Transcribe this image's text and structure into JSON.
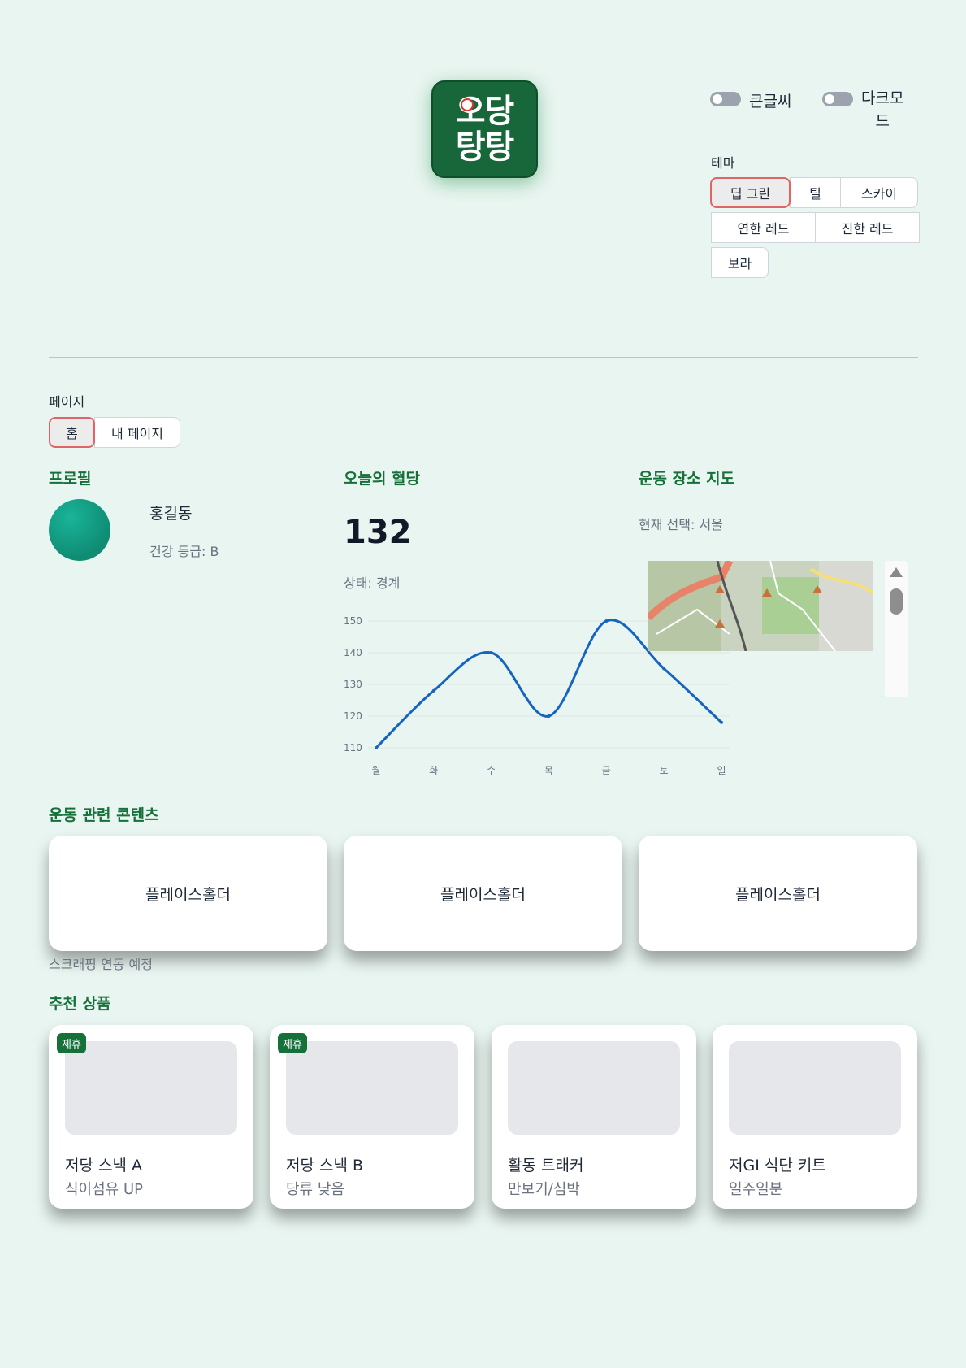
{
  "logo": {
    "line1": "오당",
    "line2": "탕탕"
  },
  "settings": {
    "large_text_label": "큰글씨",
    "dark_mode_label_1": "다크모",
    "dark_mode_label_2": "드",
    "theme_label": "테마",
    "themes": [
      "딥 그린",
      "틸",
      "스카이",
      "연한 레드",
      "진한 레드",
      "보라"
    ],
    "selected_theme": "딥 그린"
  },
  "nav": {
    "label": "페이지",
    "tabs": [
      "홈",
      "내 페이지"
    ],
    "selected": "홈"
  },
  "profile": {
    "title": "프로필",
    "name": "홍길동",
    "grade": "건강 등급: B"
  },
  "glucose": {
    "title": "오늘의 혈당",
    "value": "132",
    "status": "상태: 경계"
  },
  "chart_data": {
    "type": "line",
    "categories": [
      "월",
      "화",
      "수",
      "목",
      "금",
      "토",
      "일"
    ],
    "values": [
      110,
      128,
      140,
      120,
      150,
      135,
      118
    ],
    "y_ticks": [
      110,
      120,
      130,
      140,
      150
    ],
    "ylim": [
      110,
      150
    ],
    "grid": true,
    "color": "#1565c0"
  },
  "map": {
    "title": "운동 장소 지도",
    "selection": "현재 선택: 서울"
  },
  "content": {
    "title": "운동 관련 콘텐츠",
    "cards": [
      "플레이스홀더",
      "플레이스홀더",
      "플레이스홀더"
    ],
    "note": "스크래핑 연동 예정"
  },
  "products": {
    "title": "추천 상품",
    "items": [
      {
        "badge": "제휴",
        "name": "저당 스낵 A",
        "desc": "식이섬유 UP"
      },
      {
        "badge": "제휴",
        "name": "저당 스낵 B",
        "desc": "당류 낮음"
      },
      {
        "badge": "",
        "name": "활동 트래커",
        "desc": "만보기/심박"
      },
      {
        "badge": "",
        "name": "저GI 식단 키트",
        "desc": "일주일분"
      }
    ]
  },
  "colors": {
    "background": "#e9f5f0",
    "accent": "#16703a",
    "active_border": "#e06464",
    "badge": "#16703a"
  }
}
